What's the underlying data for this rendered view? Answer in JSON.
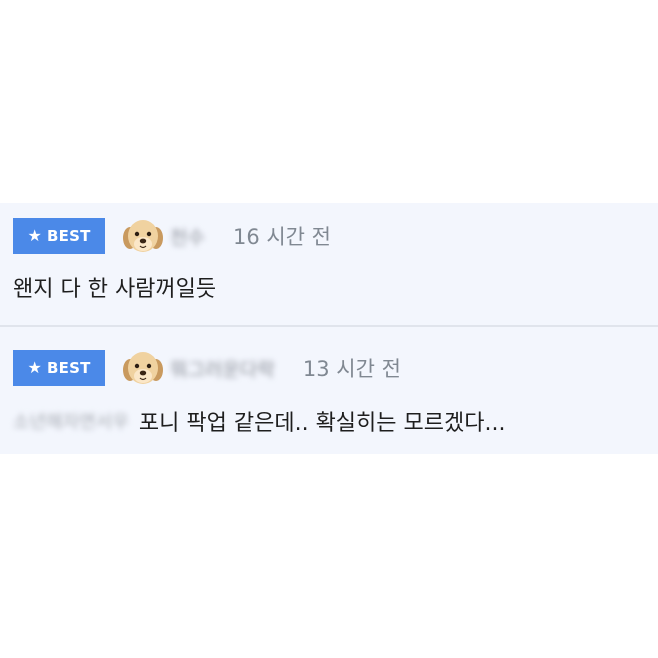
{
  "comments": [
    {
      "badge": "BEST",
      "badge_icon": "star-icon",
      "avatar_icon": "puppy-avatar-icon",
      "username": "천수",
      "time": "16 시간 전",
      "body": "왠지 다 한 사람꺼일듯"
    },
    {
      "badge": "BEST",
      "badge_icon": "star-icon",
      "avatar_icon": "puppy-avatar-icon",
      "username": "뭐그러운다락",
      "time": "13 시간 전",
      "reply_to": "소년해자면서우",
      "body": "포니 팍업 같은데.. 확실히는 모르겠다..."
    }
  ],
  "colors": {
    "badge_bg": "#4b89e8",
    "comments_bg": "#f3f6fd",
    "divider": "#e0e4ec",
    "time_text": "#808892",
    "body_text": "#1e1e1e"
  }
}
